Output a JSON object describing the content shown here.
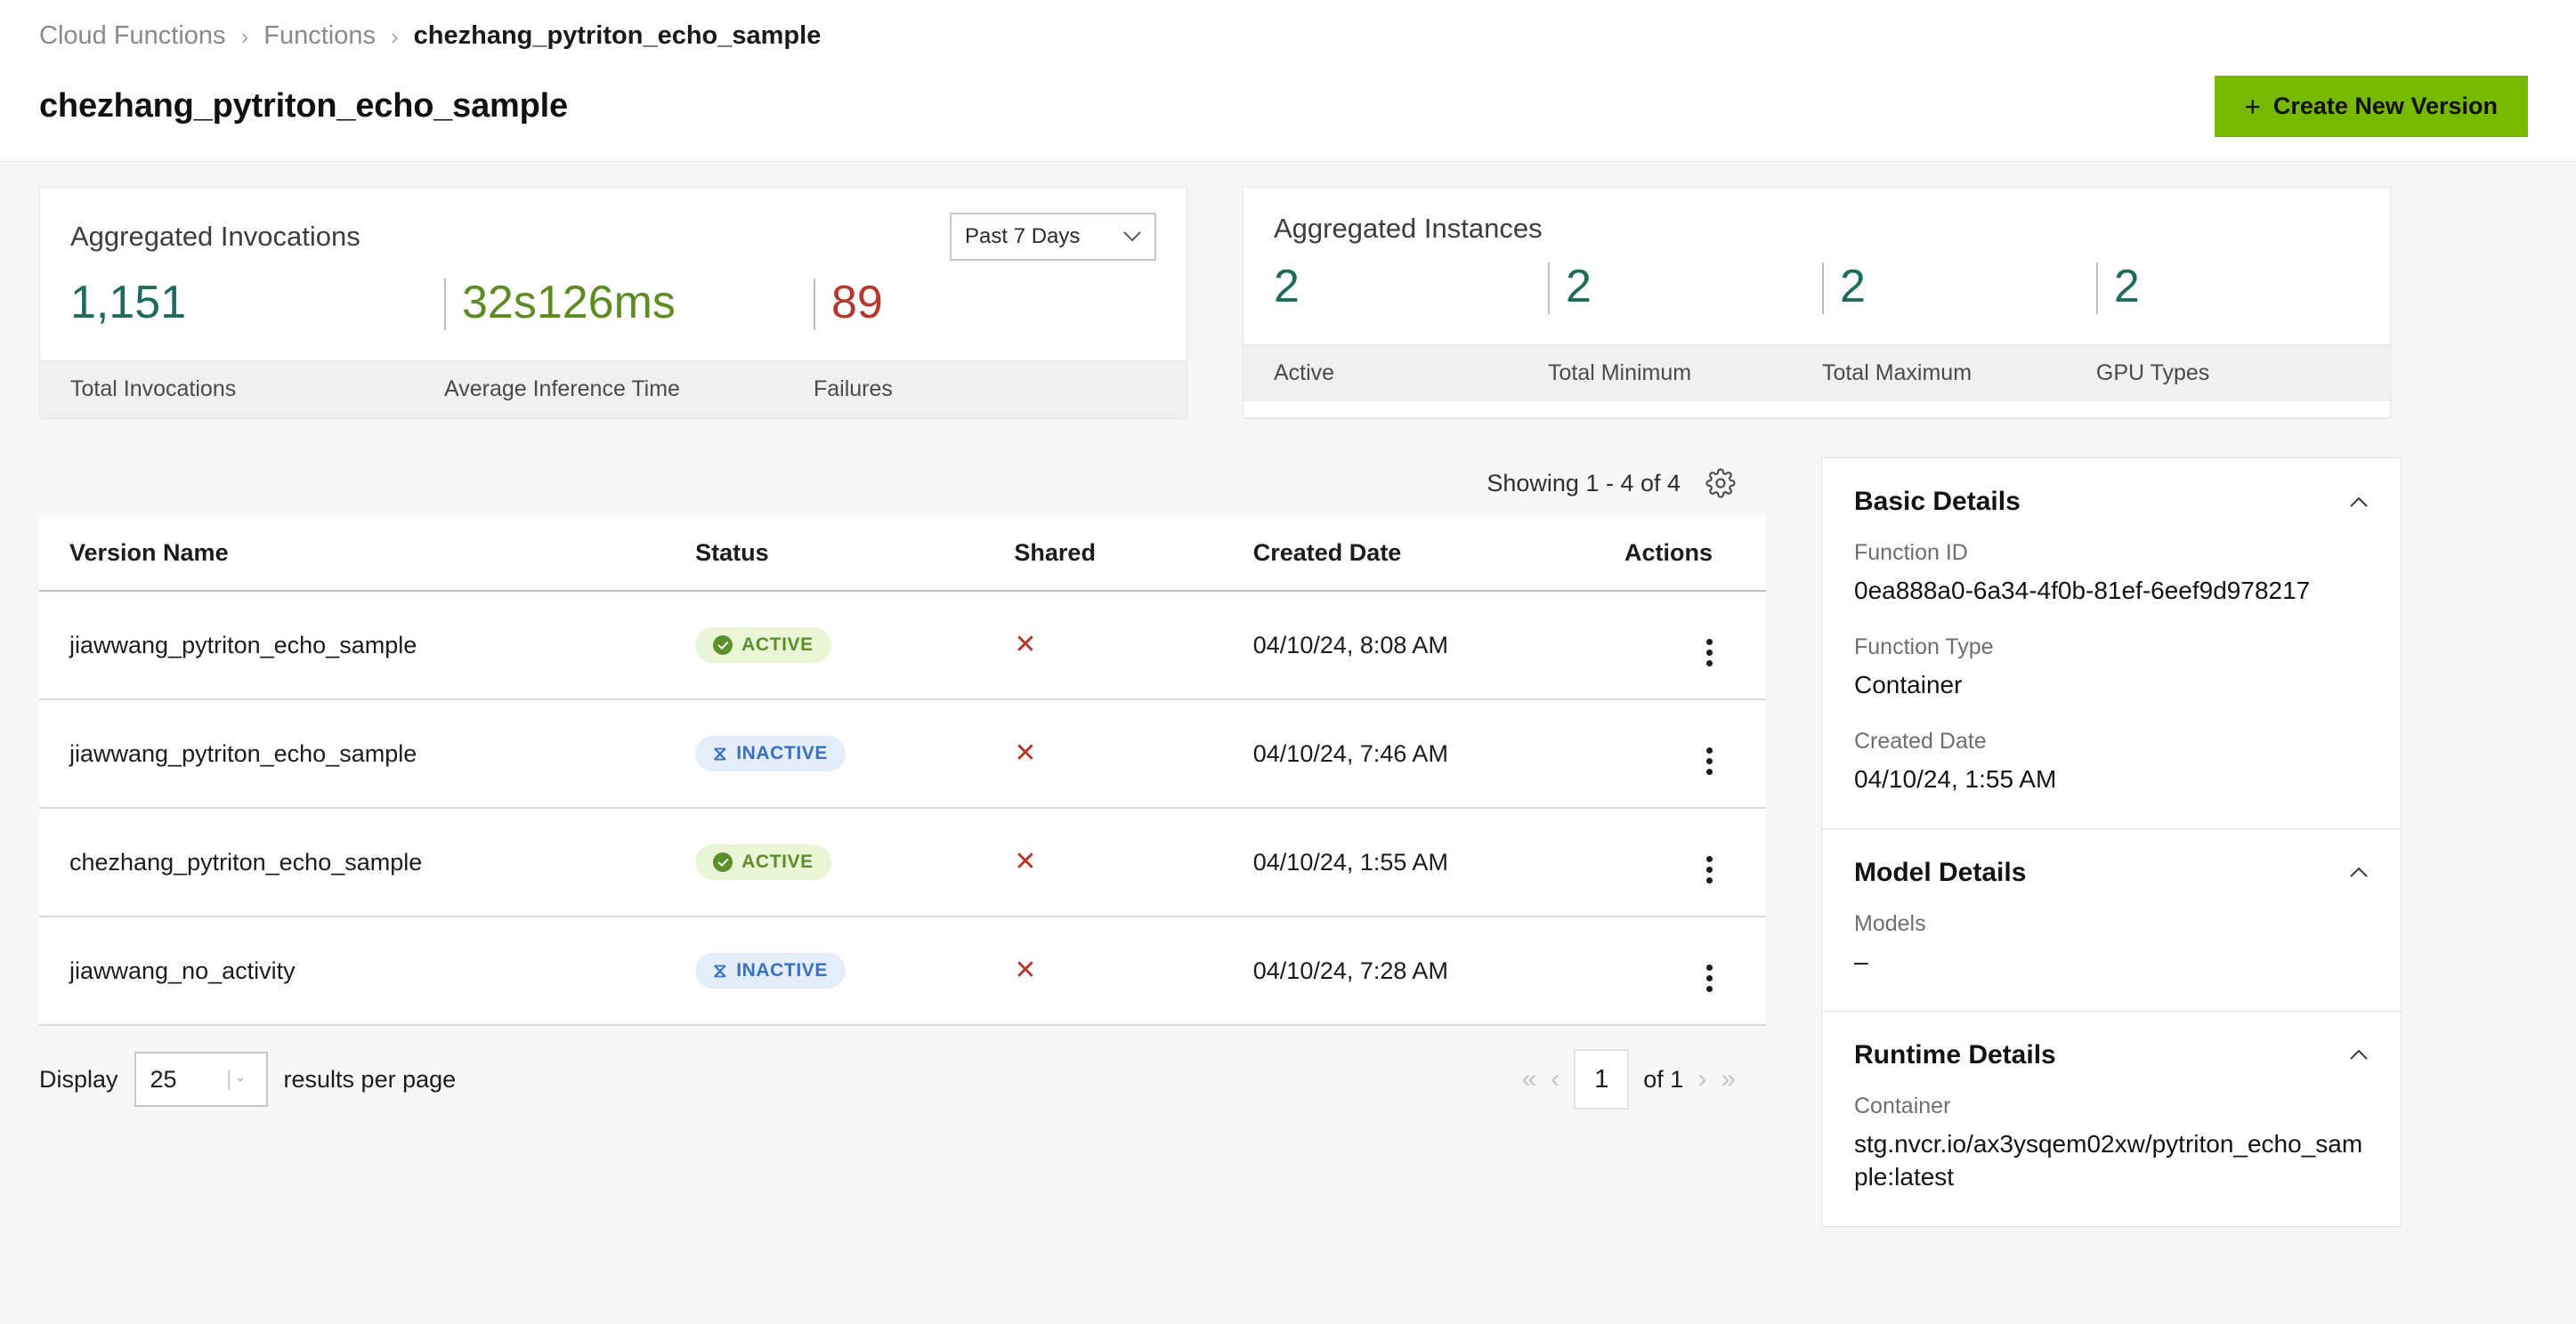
{
  "breadcrumb": {
    "root": "Cloud Functions",
    "section": "Functions",
    "current": "chezhang_pytriton_echo_sample",
    "separator": "›"
  },
  "header": {
    "title": "chezhang_pytriton_echo_sample",
    "create_button": "Create New Version",
    "create_button_plus": "+",
    "accent_color": "#76b900"
  },
  "invocations_card": {
    "title": "Aggregated Invocations",
    "range_selected": "Past 7 Days",
    "chevron": "⌄",
    "metrics": [
      {
        "value": "1,151",
        "label": "Total Invocations",
        "color": "#1e6b5e"
      },
      {
        "value": "32s126ms",
        "label": "Average Inference Time",
        "color": "#5e8c23"
      },
      {
        "value": "89",
        "label": "Failures",
        "color": "#b5382c"
      }
    ]
  },
  "instances_card": {
    "title": "Aggregated Instances",
    "metrics": [
      {
        "value": "2",
        "label": "Active",
        "color": "#1e6b5e"
      },
      {
        "value": "2",
        "label": "Total Minimum",
        "color": "#1e6b5e"
      },
      {
        "value": "2",
        "label": "Total Maximum",
        "color": "#1e6b5e"
      },
      {
        "value": "2",
        "label": "GPU Types",
        "color": "#1e6b5e"
      }
    ]
  },
  "table": {
    "showing": "Showing 1 - 4 of 4",
    "settings_icon": "gear-icon",
    "columns": {
      "name": "Version Name",
      "status": "Status",
      "shared": "Shared",
      "created": "Created Date",
      "actions": "Actions"
    },
    "rows": [
      {
        "name": "jiawwang_pytriton_echo_sample",
        "status": "ACTIVE",
        "status_kind": "active",
        "shared": "✕",
        "created": "04/10/24, 8:08 AM"
      },
      {
        "name": "jiawwang_pytriton_echo_sample",
        "status": "INACTIVE",
        "status_kind": "inactive",
        "shared": "✕",
        "created": "04/10/24, 7:46 AM"
      },
      {
        "name": "chezhang_pytriton_echo_sample",
        "status": "ACTIVE",
        "status_kind": "active",
        "shared": "✕",
        "created": "04/10/24, 1:55 AM"
      },
      {
        "name": "jiawwang_no_activity",
        "status": "INACTIVE",
        "status_kind": "inactive",
        "shared": "✕",
        "created": "04/10/24, 7:28 AM"
      }
    ]
  },
  "footer": {
    "display_label": "Display",
    "per_page_value": "25",
    "per_page_suffix": "results per page",
    "first_page": "«",
    "prev_page": "‹",
    "current_page": "1",
    "of_total": "of 1",
    "next_page": "›",
    "last_page": "»"
  },
  "sidebar": {
    "panels": [
      {
        "title": "Basic Details",
        "caret": "⌃",
        "fields": [
          {
            "label": "Function ID",
            "value": "0ea888a0-6a34-4f0b-81ef-6eef9d978217"
          },
          {
            "label": "Function Type",
            "value": "Container"
          },
          {
            "label": "Created Date",
            "value": "04/10/24, 1:55 AM"
          }
        ]
      },
      {
        "title": "Model Details",
        "caret": "⌃",
        "fields": [
          {
            "label": "Models",
            "value": "–"
          }
        ]
      },
      {
        "title": "Runtime Details",
        "caret": "⌃",
        "fields": [
          {
            "label": "Container",
            "value": "stg.nvcr.io/ax3ysqem02xw/pytriton_echo_sample:latest"
          }
        ]
      }
    ]
  }
}
